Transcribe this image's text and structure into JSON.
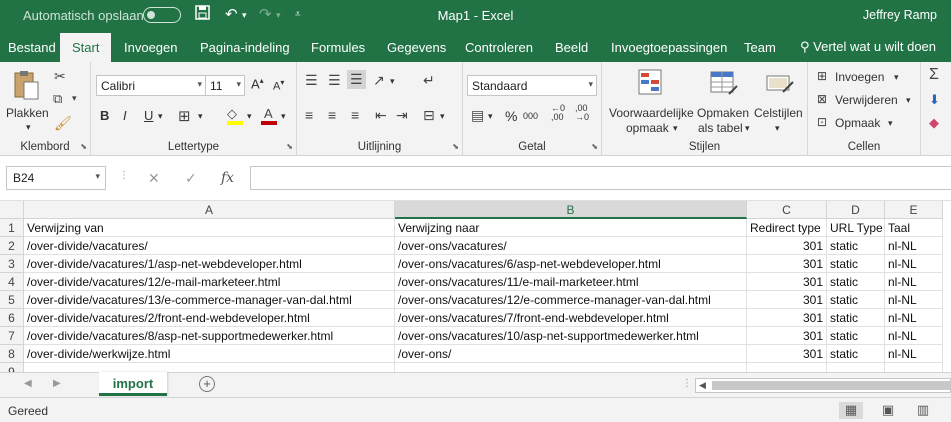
{
  "titlebar": {
    "autosave_label": "Automatisch opslaan",
    "title": "Map1  -  Excel",
    "user": "Jeffrey Ramp"
  },
  "tabs": [
    "Bestand",
    "Start",
    "Invoegen",
    "Pagina-indeling",
    "Formules",
    "Gegevens",
    "Controleren",
    "Beeld",
    "Invoegtoepassingen",
    "Team"
  ],
  "active_tab": "Start",
  "tell_me": "Vertel wat u wilt doen",
  "ribbon": {
    "clipboard": {
      "paste": "Plakken",
      "label": "Klembord"
    },
    "font": {
      "name": "Calibri",
      "size": "11",
      "label": "Lettertype",
      "bold": "B",
      "italic": "I",
      "underline": "U"
    },
    "alignment": {
      "label": "Uitlijning"
    },
    "number": {
      "format": "Standaard",
      "label": "Getal",
      "percent": "%",
      "thousands": "000"
    },
    "styles": {
      "conditional_1": "Voorwaardelijke",
      "conditional_2": "opmaak",
      "format_table_1": "Opmaken",
      "format_table_2": "als tabel",
      "cell_styles": "Celstijlen",
      "label": "Stijlen"
    },
    "cells": {
      "insert": "Invoegen",
      "delete": "Verwijderen",
      "format": "Opmaak",
      "label": "Cellen"
    },
    "colors": {
      "highlight": "#ffff00",
      "font_color": "#c00000"
    }
  },
  "formula_bar": {
    "name_box": "B24",
    "fx": "fx",
    "content": ""
  },
  "columns": [
    {
      "letter": "A",
      "width": 371
    },
    {
      "letter": "B",
      "width": 352,
      "selected": true
    },
    {
      "letter": "C",
      "width": 80
    },
    {
      "letter": "D",
      "width": 58
    },
    {
      "letter": "E",
      "width": 58
    }
  ],
  "rows": [
    {
      "num": "1",
      "cells": [
        "Verwijzing van",
        "Verwijzing naar",
        "Redirect type",
        "URL Type",
        "Taal"
      ]
    },
    {
      "num": "2",
      "cells": [
        "/over-divide/vacatures/",
        "/over-ons/vacatures/",
        "301",
        "static",
        "nl-NL"
      ]
    },
    {
      "num": "3",
      "cells": [
        "/over-divide/vacatures/1/asp-net-webdeveloper.html",
        "/over-ons/vacatures/6/asp-net-webdeveloper.html",
        "301",
        "static",
        "nl-NL"
      ]
    },
    {
      "num": "4",
      "cells": [
        "/over-divide/vacatures/12/e-mail-marketeer.html",
        "/over-ons/vacatures/11/e-mail-marketeer.html",
        "301",
        "static",
        "nl-NL"
      ]
    },
    {
      "num": "5",
      "cells": [
        "/over-divide/vacatures/13/e-commerce-manager-van-dal.html",
        "/over-ons/vacatures/12/e-commerce-manager-van-dal.html",
        "301",
        "static",
        "nl-NL"
      ]
    },
    {
      "num": "6",
      "cells": [
        "/over-divide/vacatures/2/front-end-webdeveloper.html",
        "/over-ons/vacatures/7/front-end-webdeveloper.html",
        "301",
        "static",
        "nl-NL"
      ]
    },
    {
      "num": "7",
      "cells": [
        "/over-divide/vacatures/8/asp-net-supportmedewerker.html",
        "/over-ons/vacatures/10/asp-net-supportmedewerker.html",
        "301",
        "static",
        "nl-NL"
      ]
    },
    {
      "num": "8",
      "cells": [
        "/over-divide/werkwijze.html",
        "/over-ons/",
        "301",
        "static",
        "nl-NL"
      ]
    },
    {
      "num": "9",
      "cells": [
        "",
        "",
        "",
        "",
        ""
      ]
    }
  ],
  "sheet_tab": "import",
  "status": "Gereed",
  "accent_color": "#217346"
}
